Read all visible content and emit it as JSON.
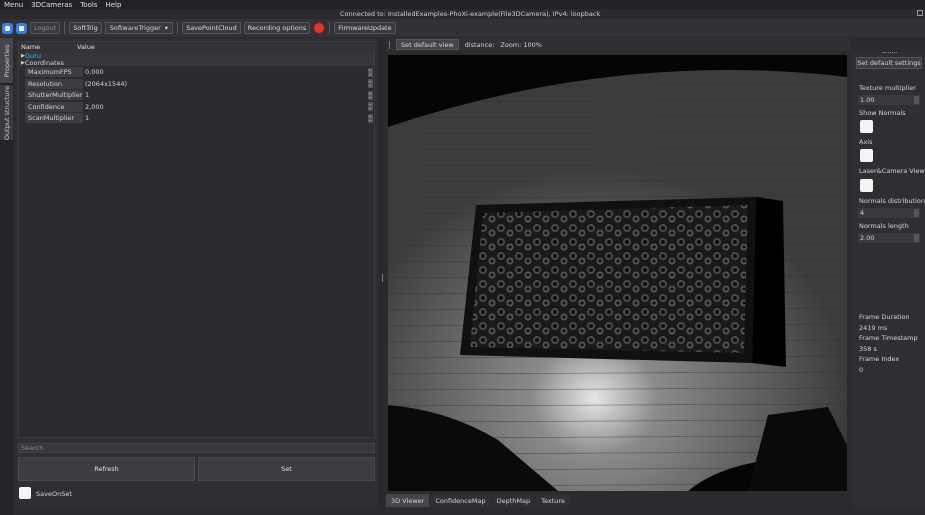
{
  "menu": {
    "items": [
      "Menu",
      "3DCameras",
      "Tools",
      "Help"
    ],
    "connection_status": "Connected to: InstalledExamples-PhoXi-example(File3DCamera), IPv4: loopback"
  },
  "toolbar": {
    "logout": "Logout",
    "trigger_label": "SoftTrig",
    "trigger_select": "SoftwareTrigger",
    "save_point_cloud": "SavePointCloud",
    "recording_options": "Recording options",
    "firmware_update": "FirmwareUpdate",
    "stop_color": "#d23b2e"
  },
  "side_tabs": [
    "Properties",
    "Output structure"
  ],
  "properties": {
    "col_name": "Name",
    "col_value": "Value",
    "groups": [
      "Guru",
      "Coordinates"
    ],
    "rows": [
      {
        "name": "MaximumFPS",
        "value": "0,000",
        "spin": true
      },
      {
        "name": "Resolution",
        "value": "(2064x1544)",
        "spin": true
      },
      {
        "name": "ShutterMultiplier",
        "value": "1",
        "spin": true
      },
      {
        "name": "Confidence",
        "value": "2,000",
        "spin": true
      },
      {
        "name": "ScanMultiplier",
        "value": "1",
        "spin": true
      }
    ],
    "search_placeholder": "Search",
    "refresh": "Refresh",
    "set": "Set",
    "save_on_set": "SaveOnSet"
  },
  "viewer": {
    "set_default_view": "Set default view",
    "distance_label": "distance:",
    "zoom": "Zoom: 100%",
    "tabs": [
      "3D Viewer",
      "ConfidenceMap",
      "DepthMap",
      "Texture"
    ],
    "active_tab": "3D Viewer"
  },
  "settings": {
    "set_default_settings": "Set default settings",
    "texture_multiplier_label": "Texture multiplier",
    "texture_multiplier": "1.00",
    "show_normals": "Show Normals",
    "axis": "Axis",
    "laser_camera_view": "Laser&Camera View",
    "normals_distribution_label": "Normals distribution",
    "normals_distribution": "4",
    "normals_length_label": "Normals length",
    "normals_length": "2.00",
    "frame_duration_label": "Frame Duration",
    "frame_duration": "2419 ms",
    "frame_timestamp_label": "Frame Timestamp",
    "frame_timestamp": "358 s",
    "frame_index_label": "Frame Index",
    "frame_index": "0"
  }
}
